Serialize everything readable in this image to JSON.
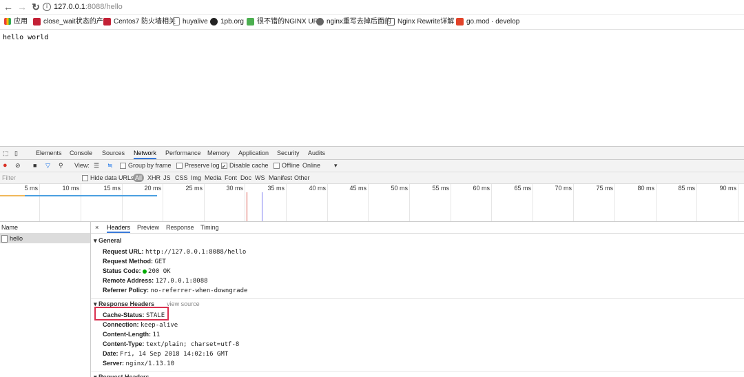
{
  "browser": {
    "url_host": "127.0.0.1",
    "url_path": ":8088/hello",
    "bookmarks": [
      {
        "label": "应用",
        "icon": "apps-grid-icon",
        "color": "#4285f4"
      },
      {
        "label": "close_wait状态的产",
        "icon": "csdn-icon",
        "color": "#c32136"
      },
      {
        "label": "Centos7 防火墙相关",
        "icon": "csdn-icon",
        "color": "#c32136"
      },
      {
        "label": "huyalive",
        "icon": "page-icon",
        "color": "#888888"
      },
      {
        "label": "1pb.org",
        "icon": "github-icon",
        "color": "#222222"
      },
      {
        "label": "很不错的NGINX URL",
        "icon": "green-square-icon",
        "color": "#4caf50"
      },
      {
        "label": "nginx重写去掉后面的",
        "icon": "gray-logo-icon",
        "color": "#666666"
      },
      {
        "label": "Nginx Rewrite详解",
        "icon": "script-icon",
        "color": "#555555"
      },
      {
        "label": "go.mod · develop",
        "icon": "gitlab-icon",
        "color": "#e24329"
      }
    ]
  },
  "page": {
    "body_text": "hello world"
  },
  "devtools": {
    "tabs": [
      "Elements",
      "Console",
      "Sources",
      "Network",
      "Performance",
      "Memory",
      "Application",
      "Security",
      "Audits"
    ],
    "active_tab": "Network",
    "toolbar": {
      "view_label": "View:",
      "group_by_frame": "Group by frame",
      "preserve_log": "Preserve log",
      "disable_cache": "Disable cache",
      "offline": "Offline",
      "online": "Online"
    },
    "filter": {
      "placeholder": "Filter",
      "hide_data_urls": "Hide data URLs",
      "types": [
        "All",
        "XHR",
        "JS",
        "CSS",
        "Img",
        "Media",
        "Font",
        "Doc",
        "WS",
        "Manifest",
        "Other"
      ]
    },
    "timeline_ticks": [
      "5 ms",
      "10 ms",
      "15 ms",
      "20 ms",
      "25 ms",
      "30 ms",
      "35 ms",
      "40 ms",
      "45 ms",
      "50 ms",
      "55 ms",
      "60 ms",
      "65 ms",
      "70 ms",
      "75 ms",
      "80 ms",
      "85 ms",
      "90 ms"
    ],
    "name_header": "Name",
    "request_name": "hello",
    "detail_tabs": [
      "Headers",
      "Preview",
      "Response",
      "Timing"
    ],
    "close_glyph": "×",
    "general": {
      "title": "▾ General",
      "rows": [
        {
          "k": "Request URL:",
          "v": "http://127.0.0.1:8088/hello"
        },
        {
          "k": "Request Method:",
          "v": "GET"
        },
        {
          "k": "Status Code:",
          "v": "200 OK"
        },
        {
          "k": "Remote Address:",
          "v": "127.0.0.1:8088"
        },
        {
          "k": "Referrer Policy:",
          "v": "no-referrer-when-downgrade"
        }
      ]
    },
    "response_headers": {
      "title": "▾ Response Headers",
      "view_source": "view source",
      "rows": [
        {
          "k": "Cache-Status:",
          "v": "STALE"
        },
        {
          "k": "Connection:",
          "v": "keep-alive"
        },
        {
          "k": "Content-Length:",
          "v": "11"
        },
        {
          "k": "Content-Type:",
          "v": "text/plain; charset=utf-8"
        },
        {
          "k": "Date:",
          "v": "Fri, 14 Sep 2018 14:02:16 GMT"
        },
        {
          "k": "Server:",
          "v": "nginx/1.13.10"
        }
      ]
    },
    "request_headers_partial": "▾ Request Headers"
  }
}
